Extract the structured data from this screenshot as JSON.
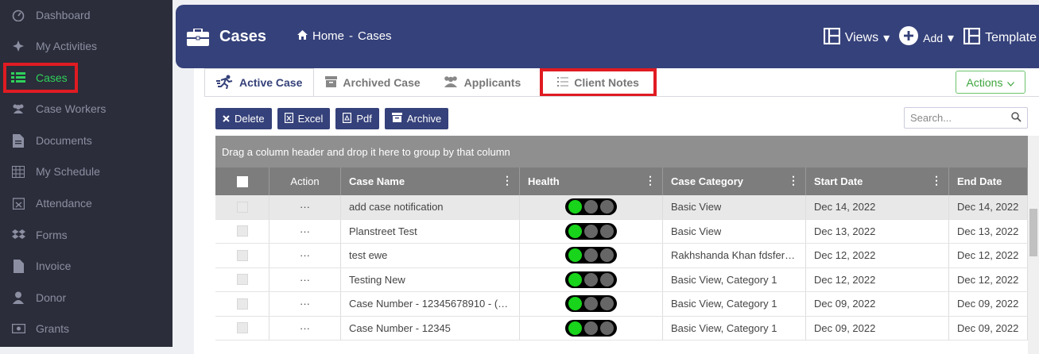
{
  "sidebar": {
    "items": [
      {
        "label": "Dashboard",
        "icon": "dashboard-icon"
      },
      {
        "label": "My Activities",
        "icon": "activities-icon"
      },
      {
        "label": "Cases",
        "icon": "list-icon",
        "active": true
      },
      {
        "label": "Case Workers",
        "icon": "users-icon"
      },
      {
        "label": "Documents",
        "icon": "document-icon"
      },
      {
        "label": "My Schedule",
        "icon": "calendar-grid-icon"
      },
      {
        "label": "Attendance",
        "icon": "calendar-x-icon"
      },
      {
        "label": "Forms",
        "icon": "dropbox-icon"
      },
      {
        "label": "Invoice",
        "icon": "file-icon"
      },
      {
        "label": "Donor",
        "icon": "user-icon"
      },
      {
        "label": "Grants",
        "icon": "money-icon"
      }
    ]
  },
  "header": {
    "title": "Cases",
    "breadcrumb": {
      "home": "Home",
      "separator": "-",
      "current": "Cases"
    },
    "views_label": "Views",
    "add_label": "Add",
    "template_label": "Template"
  },
  "tabs": [
    {
      "label": "Active Case",
      "icon": "running-icon"
    },
    {
      "label": "Archived Case",
      "icon": "archive-box-icon"
    },
    {
      "label": "Applicants",
      "icon": "users-icon"
    },
    {
      "label": "Client Notes",
      "icon": "list-icon"
    }
  ],
  "actions_label": "Actions",
  "toolbar": {
    "delete_label": "Delete",
    "excel_label": "Excel",
    "pdf_label": "Pdf",
    "archive_label": "Archive",
    "search_placeholder": "Search..."
  },
  "grid": {
    "group_hint": "Drag a column header and drop it here to group by that column",
    "columns": [
      "Action",
      "Case Name",
      "Health",
      "Case Category",
      "Start Date",
      "End Date"
    ],
    "action_glyph": "···",
    "rows": [
      {
        "case_name": "add case notification",
        "category": "Basic View",
        "start": "Dec 14, 2022",
        "end": "Dec 14, 2022",
        "health_green": 1
      },
      {
        "case_name": "Planstreet Test",
        "category": "Basic View",
        "start": "Dec 13, 2022",
        "end": "Dec 13, 2022",
        "health_green": 1
      },
      {
        "case_name": "test ewe",
        "category": "Rakhshanda Khan fdsfer…",
        "start": "Dec 12, 2022",
        "end": "Dec 12, 2022",
        "health_green": 1
      },
      {
        "case_name": "Testing New",
        "category": "Basic View, Category 1",
        "start": "Dec 12, 2022",
        "end": "Dec 12, 2022",
        "health_green": 1
      },
      {
        "case_name": "Case Number - 12345678910 - (…",
        "category": "Basic View, Category 1",
        "start": "Dec 09, 2022",
        "end": "Dec 09, 2022",
        "health_green": 1
      },
      {
        "case_name": "Case Number - 12345",
        "category": "Basic View, Category 1",
        "start": "Dec 09, 2022",
        "end": "Dec 09, 2022",
        "health_green": 1
      }
    ]
  },
  "colors": {
    "sidebar_bg": "#2b2d3a",
    "header_bg": "#35417a",
    "active_green": "#2fd15a",
    "highlight_red": "#e01b22",
    "light_green": "#18d41b"
  }
}
